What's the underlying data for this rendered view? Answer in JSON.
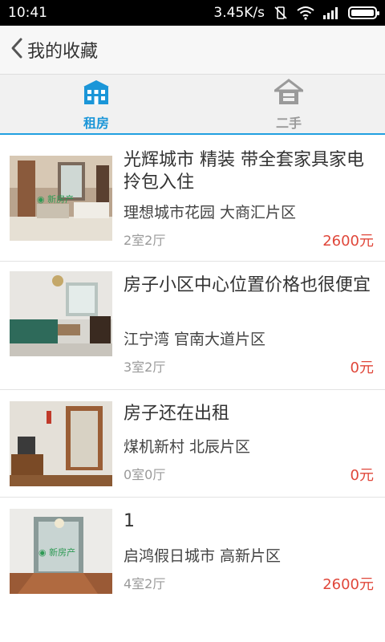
{
  "status_bar": {
    "time": "10:41",
    "speed": "3.45K/s"
  },
  "header": {
    "back_label": "我的收藏"
  },
  "tabs": [
    {
      "label": "租房",
      "icon": "building-icon",
      "active": true
    },
    {
      "label": "二手",
      "icon": "house-icon",
      "active": false
    }
  ],
  "colors": {
    "accent": "#1b96d8",
    "price": "#e0473a"
  },
  "listings": [
    {
      "title": "光辉城市 精装 带全套家具家电 拎包入住",
      "location": "理想城市花园 大商汇片区",
      "layout": "2室2厅",
      "price": "2600元"
    },
    {
      "title": "房子小区中心位置价格也很便宜",
      "location": "江宁湾 官南大道片区",
      "layout": "3室2厅",
      "price": "0元"
    },
    {
      "title": "房子还在出租",
      "location": "煤机新村 北辰片区",
      "layout": "0室0厅",
      "price": "0元"
    },
    {
      "title": "1",
      "location": "启鸿假日城市 高新片区",
      "layout": "4室2厅",
      "price": "2600元"
    }
  ]
}
